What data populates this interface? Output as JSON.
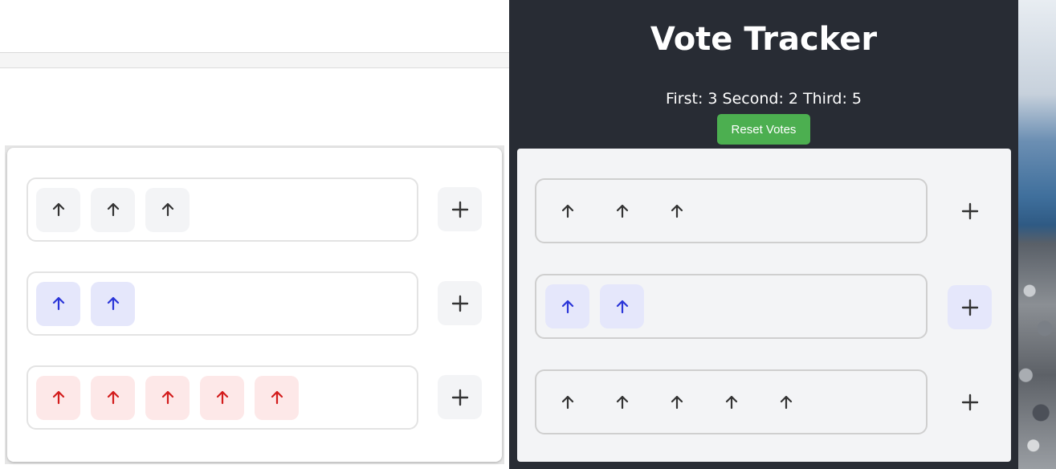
{
  "tracker": {
    "title": "Vote Tracker",
    "counts_text": "First: 3 Second: 2 Third: 5",
    "reset_label": "Reset Votes"
  },
  "votes": {
    "first": 3,
    "second": 2,
    "third": 5
  },
  "icons": {
    "vote": "arrow-up-icon",
    "add": "plus-icon"
  },
  "colors": {
    "panel_bg": "#282c34",
    "reset_button": "#4caf50",
    "first_fg": "#333333",
    "first_bg": "#f3f4f6",
    "second_fg": "#2a35d8",
    "second_bg": "#e5e7fb",
    "third_fg": "#d31c1c",
    "third_bg": "#fde8e8"
  }
}
